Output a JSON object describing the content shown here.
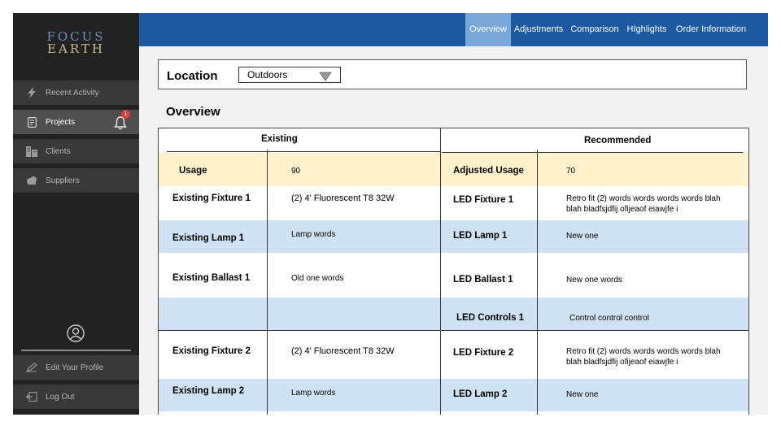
{
  "sidebar": {
    "logo": {
      "line1": "FOCUS",
      "line2": "EARTH"
    },
    "items": [
      {
        "label": "Recent Activity",
        "icon": "lightning-icon"
      },
      {
        "label": "Projects",
        "icon": "document-icon",
        "active": true,
        "badge": "1"
      },
      {
        "label": "Clients",
        "icon": "building-icon"
      },
      {
        "label": "Suppliers",
        "icon": "cloud-icon"
      }
    ],
    "footer": [
      {
        "label": "Edit Your Profile",
        "icon": "edit-icon"
      },
      {
        "label": "Log Out",
        "icon": "logout-icon"
      }
    ]
  },
  "header": {
    "tabs": [
      {
        "label": "Overview",
        "active": true
      },
      {
        "label": "Adjustments"
      },
      {
        "label": "Comparison"
      },
      {
        "label": "HIghlights"
      },
      {
        "label": "Order Information"
      }
    ]
  },
  "location": {
    "label": "Location",
    "selected": "Outdoors"
  },
  "overview": {
    "title": "Overview",
    "existing_header": "Existing",
    "recommended_header": "Recommended",
    "rows": [
      {
        "e_label": "Usage",
        "e_value": "90",
        "r_label": "Adjusted Usage",
        "r_value": "70"
      },
      {
        "e_label": "Existing Fixture 1",
        "e_value": "(2) 4' Fluorescent T8 32W",
        "r_label": "LED Fixture 1",
        "r_value": "Retro fit (2) words words words words blah blah bladfsjdfij ofijeaof eiawjfe i"
      },
      {
        "e_label": "Existing Lamp 1",
        "e_value": "Lamp words",
        "r_label": "LED Lamp 1",
        "r_value": "New one"
      },
      {
        "e_label": "Existing Ballast 1",
        "e_value": "Old one words",
        "r_label": "LED  Ballast 1",
        "r_value": "New one words"
      },
      {
        "e_label": "",
        "e_value": "",
        "r_label": "LED  Controls 1",
        "r_value": "Control control control"
      },
      {
        "e_label": "Existing Fixture 2",
        "e_value": "(2) 4' Fluorescent T8 32W",
        "r_label": "LED Fixture 2",
        "r_value": "Retro fit (2) words words words words blah blah bladfsjdfij ofijeaof eiawjfe i"
      },
      {
        "e_label": "Existing Lamp 2",
        "e_value": "Lamp words",
        "r_label": "LED Lamp 2",
        "r_value": "New one"
      }
    ]
  },
  "colors": {
    "sidebar_bg": "#222222",
    "topbar_bg": "#1d59a0",
    "tab_active": "#7aa7d8",
    "usage_row": "#fff2cc",
    "blue_row": "#cfe2f3"
  }
}
